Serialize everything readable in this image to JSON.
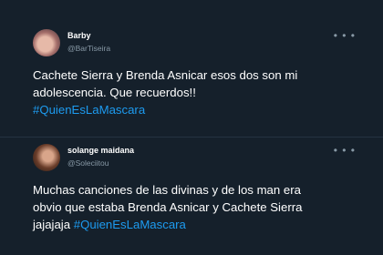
{
  "tweets": [
    {
      "display_name": "Barby",
      "handle": "@BarTiseira",
      "text_lines": [
        "Cachete Sierra y Brenda Asnicar esos dos son mi",
        "adolescencia. Que recuerdos!!"
      ],
      "hashtag": "#QuienEsLaMascara",
      "more_icon": "more-dots-icon"
    },
    {
      "display_name": "solange maidana",
      "handle": "@Soleciitou",
      "text_lines": [
        "Muchas canciones de las divinas y de los man era",
        "obvio que estaba Brenda Asnicar y Cachete Sierra"
      ],
      "text_prefix": "jajajaja ",
      "hashtag": "#QuienEsLaMascara",
      "more_icon": "more-dots-icon"
    }
  ],
  "colors": {
    "background": "#15202b",
    "divider": "#253341",
    "text": "#ffffff",
    "secondary": "#8899a6",
    "hashtag": "#1d9bf0"
  },
  "more_glyph": "• • •"
}
